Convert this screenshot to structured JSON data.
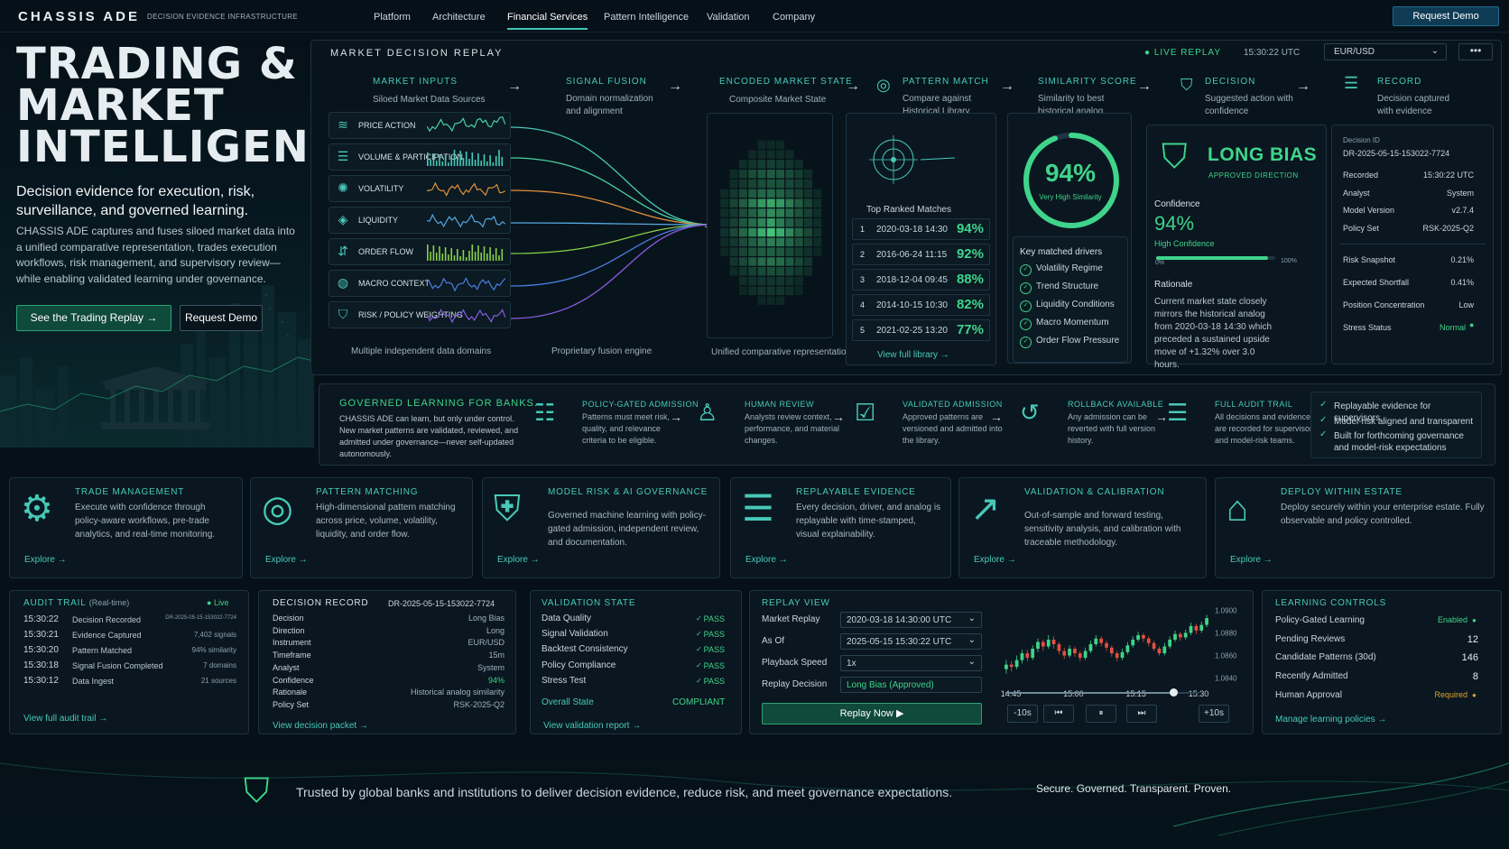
{
  "nav": {
    "logo": "CHASSIS ADE",
    "logo_sub": "DECISION EVIDENCE INFRASTRUCTURE",
    "links": [
      "Platform",
      "Architecture",
      "Financial Services",
      "Pattern Intelligence",
      "Validation",
      "Company"
    ],
    "active": "Financial Services",
    "cta": "Request Demo"
  },
  "hero": {
    "title_lines": [
      "TRADING &",
      "MARKET",
      "INTELLIGENCE"
    ],
    "subtitle": "Decision evidence for execution, risk, surveillance, and governed learning.",
    "body": "CHASSIS ADE captures and fuses siloed market data into a unified comparative representation, trades execution workflows, risk management, and supervisory review—while enabling validated learning under governance.",
    "btn_primary": "See the Trading Replay",
    "btn_secondary": "Request Demo"
  },
  "replay": {
    "title": "MARKET DECISION REPLAY",
    "live": "LIVE REPLAY",
    "time": "15:30:22 UTC",
    "pair": "EUR/USD",
    "more": "•••",
    "stages": [
      {
        "title": "MARKET INPUTS",
        "sub": "Siloed Market Data Sources"
      },
      {
        "title": "SIGNAL FUSION",
        "sub": "Domain normalization and alignment"
      },
      {
        "title": "ENCODED MARKET STATE",
        "sub": "Composite Market State"
      },
      {
        "title": "PATTERN MATCH",
        "sub": "Compare against Historical Library"
      },
      {
        "title": "SIMILARITY SCORE",
        "sub": "Similarity to best historical analog"
      },
      {
        "title": "DECISION",
        "sub": "Suggested action with confidence"
      },
      {
        "title": "RECORD",
        "sub": "Decision captured with evidence"
      }
    ],
    "inputs": [
      {
        "label": "PRICE ACTION",
        "icon": "layers-icon"
      },
      {
        "label": "VOLUME & PARTICIPATION",
        "icon": "database-icon"
      },
      {
        "label": "VOLATILITY",
        "icon": "sun-icon"
      },
      {
        "label": "LIQUIDITY",
        "icon": "drop-icon"
      },
      {
        "label": "ORDER FLOW",
        "icon": "flow-icon"
      },
      {
        "label": "MACRO CONTEXT",
        "icon": "globe-icon"
      },
      {
        "label": "RISK / POLICY WEIGHTING",
        "icon": "shield-gear-icon"
      }
    ],
    "notes": {
      "inputs": "Multiple independent data domains",
      "fusion": "Proprietary fusion engine",
      "state": "Unified comparative representation"
    },
    "matches_title": "Top Ranked Matches",
    "matches": [
      {
        "n": "1",
        "date": "2020-03-18 14:30",
        "pct": "94%"
      },
      {
        "n": "2",
        "date": "2016-06-24 11:15",
        "pct": "92%"
      },
      {
        "n": "3",
        "date": "2018-12-04 09:45",
        "pct": "88%"
      },
      {
        "n": "4",
        "date": "2014-10-15 10:30",
        "pct": "82%"
      },
      {
        "n": "5",
        "date": "2021-02-25 13:20",
        "pct": "77%"
      }
    ],
    "view_library": "View full library",
    "similarity": {
      "value": "94%",
      "label": "Very High Similarity",
      "fraction": 0.94
    },
    "drivers_title": "Key matched drivers",
    "drivers": [
      "Volatility Regime",
      "Trend Structure",
      "Liquidity Conditions",
      "Macro Momentum",
      "Order Flow Pressure"
    ],
    "decision": {
      "bias": "LONG BIAS",
      "approved": "APPROVED DIRECTION",
      "confidence_label": "Confidence",
      "confidence": "94%",
      "confidence_sub": "High Confidence",
      "bar_min": "0%",
      "bar_max": "100%",
      "bar_fraction": 0.94,
      "rationale_label": "Rationale",
      "rationale": "Current market state closely mirrors the historical analog from 2020-03-18 14:30 which preceded a sustained upside move of +1.32% over 3.0 hours."
    },
    "record": {
      "id_label": "Decision ID",
      "id": "DR-2025-05-15-153022-7724",
      "rows": [
        {
          "k": "Recorded",
          "v": "15:30:22 UTC"
        },
        {
          "k": "Analyst",
          "v": "System"
        },
        {
          "k": "Model Version",
          "v": "v2.7.4"
        },
        {
          "k": "Policy Set",
          "v": "RSK-2025-Q2"
        }
      ],
      "risk_rows": [
        {
          "k": "Risk Snapshot",
          "v": "0.21%"
        },
        {
          "k": "Expected Shortfall",
          "v": "0.41%"
        },
        {
          "k": "Position Concentration",
          "v": "Low"
        },
        {
          "k": "Stress Status",
          "v": "Normal"
        }
      ]
    }
  },
  "governed": {
    "title": "GOVERNED LEARNING FOR BANKS.",
    "body": "CHASSIS ADE can learn, but only under control. New market patterns are validated, reviewed, and admitted under governance—never self-updated autonomously.",
    "steps": [
      {
        "title": "POLICY-GATED ADMISSION",
        "text": "Patterns must meet risk, quality, and relevance criteria to be eligible."
      },
      {
        "title": "HUMAN REVIEW",
        "text": "Analysts review context, performance, and material changes."
      },
      {
        "title": "VALIDATED ADMISSION",
        "text": "Approved patterns are versioned and admitted into the library."
      },
      {
        "title": "ROLLBACK AVAILABLE",
        "text": "Any admission can be reverted with full version history."
      },
      {
        "title": "FULL AUDIT TRAIL",
        "text": "All decisions and evidence are recorded for supervisors and model-risk teams."
      }
    ],
    "checks": [
      "Replayable evidence for supervisors",
      "Model-risk aligned and transparent",
      "Built for forthcoming governance and model-risk expectations"
    ]
  },
  "features": [
    {
      "title": "TRADE MANAGEMENT",
      "text": "Execute with confidence through policy-aware workflows, pre-trade analytics, and real-time monitoring.",
      "cta": "Explore",
      "icon": "workflow-icon"
    },
    {
      "title": "PATTERN MATCHING",
      "text": "High-dimensional pattern matching across price, volume, volatility, liquidity, and order flow.",
      "cta": "Explore",
      "icon": "target-icon"
    },
    {
      "title": "MODEL RISK & AI GOVERNANCE",
      "text": "Governed machine learning with policy-gated admission, independent review, and documentation.",
      "cta": "Explore",
      "icon": "shield-icon"
    },
    {
      "title": "REPLAYABLE EVIDENCE",
      "text": "Every decision, driver, and analog is replayable with time-stamped, visual explainability.",
      "cta": "Explore",
      "icon": "database-lock-icon"
    },
    {
      "title": "VALIDATION & CALIBRATION",
      "text": "Out-of-sample and forward testing, sensitivity analysis, and calibration with traceable methodology.",
      "cta": "Explore",
      "icon": "chart-up-icon"
    },
    {
      "title": "DEPLOY WITHIN ESTATE",
      "text": "Deploy securely within your enterprise estate. Fully observable and policy controlled.",
      "cta": "Explore",
      "icon": "building-lock-icon"
    }
  ],
  "audit": {
    "title": "AUDIT TRAIL",
    "sub": "(Real-time)",
    "live": "Live",
    "rows": [
      {
        "t": "15:30:22",
        "e": "Decision Recorded",
        "v": "DR-2025-05-15-153022-7724"
      },
      {
        "t": "15:30:21",
        "e": "Evidence Captured",
        "v": "7,402 signals"
      },
      {
        "t": "15:30:20",
        "e": "Pattern Matched",
        "v": "94% similarity"
      },
      {
        "t": "15:30:18",
        "e": "Signal Fusion Completed",
        "v": "7 domains"
      },
      {
        "t": "15:30:12",
        "e": "Data Ingest",
        "v": "21 sources"
      }
    ],
    "link": "View full audit trail"
  },
  "decision_record": {
    "title": "DECISION RECORD",
    "id": "DR-2025-05-15-153022-7724",
    "rows": [
      {
        "k": "Decision",
        "v": "Long Bias"
      },
      {
        "k": "Direction",
        "v": "Long"
      },
      {
        "k": "Instrument",
        "v": "EUR/USD"
      },
      {
        "k": "Timeframe",
        "v": "15m"
      },
      {
        "k": "Analyst",
        "v": "System"
      },
      {
        "k": "Confidence",
        "v": "94%"
      },
      {
        "k": "Rationale",
        "v": "Historical analog similarity"
      },
      {
        "k": "Policy Set",
        "v": "RSK-2025-Q2"
      }
    ],
    "link": "View decision packet"
  },
  "validation": {
    "title": "VALIDATION STATE",
    "rows": [
      {
        "k": "Data Quality",
        "v": "PASS"
      },
      {
        "k": "Signal Validation",
        "v": "PASS"
      },
      {
        "k": "Backtest Consistency",
        "v": "PASS"
      },
      {
        "k": "Policy Compliance",
        "v": "PASS"
      },
      {
        "k": "Stress Test",
        "v": "PASS"
      }
    ],
    "overall_label": "Overall State",
    "overall": "COMPLIANT",
    "link": "View validation report"
  },
  "replay_view": {
    "title": "REPLAY VIEW",
    "fields": [
      {
        "k": "Market Replay",
        "v": "2020-03-18 14:30:00 UTC",
        "select": true
      },
      {
        "k": "As Of",
        "v": "2025-05-15 15:30:22 UTC",
        "select": true
      },
      {
        "k": "Playback Speed",
        "v": "1x",
        "select": true
      },
      {
        "k": "Replay Decision",
        "v": "Long Bias (Approved)",
        "select": false
      }
    ],
    "button": "Replay Now",
    "controls": [
      "-10s",
      "⏮",
      "⏸",
      "⏭",
      "+10s"
    ],
    "progress": 0.87
  },
  "chart_data": {
    "type": "candlestick",
    "x_ticks": [
      "14:45",
      "15:00",
      "15:15",
      "15:30"
    ],
    "y_ticks": [
      "1.0900",
      "1.0880",
      "1.0860",
      "1.0840"
    ],
    "ylim": [
      1.0835,
      1.0905
    ],
    "candles": [
      [
        1.0848,
        1.0852,
        1.0844,
        1.0856
      ],
      [
        1.0852,
        1.085,
        1.0846,
        1.0855
      ],
      [
        1.085,
        1.0856,
        1.0848,
        1.086
      ],
      [
        1.0856,
        1.0862,
        1.0853,
        1.0865
      ],
      [
        1.0862,
        1.0858,
        1.0855,
        1.0865
      ],
      [
        1.0858,
        1.0866,
        1.0856,
        1.0869
      ],
      [
        1.0866,
        1.0872,
        1.0863,
        1.0875
      ],
      [
        1.0872,
        1.0868,
        1.0864,
        1.0874
      ],
      [
        1.0868,
        1.0874,
        1.0866,
        1.0878
      ],
      [
        1.0874,
        1.087,
        1.0866,
        1.0877
      ],
      [
        1.087,
        1.0864,
        1.0861,
        1.0872
      ],
      [
        1.0864,
        1.086,
        1.0857,
        1.0867
      ],
      [
        1.086,
        1.0866,
        1.0858,
        1.0869
      ],
      [
        1.0866,
        1.0862,
        1.0859,
        1.0868
      ],
      [
        1.0862,
        1.0858,
        1.0855,
        1.0864
      ],
      [
        1.0858,
        1.0864,
        1.0856,
        1.0867
      ],
      [
        1.0864,
        1.087,
        1.0862,
        1.0873
      ],
      [
        1.087,
        1.0875,
        1.0868,
        1.0878
      ],
      [
        1.0875,
        1.0871,
        1.0868,
        1.0877
      ],
      [
        1.0871,
        1.0867,
        1.0864,
        1.0873
      ],
      [
        1.0867,
        1.0862,
        1.0859,
        1.0869
      ],
      [
        1.0862,
        1.0858,
        1.0855,
        1.0864
      ],
      [
        1.0858,
        1.0863,
        1.0856,
        1.0866
      ],
      [
        1.0863,
        1.0869,
        1.0861,
        1.0872
      ],
      [
        1.0869,
        1.0874,
        1.0867,
        1.0877
      ],
      [
        1.0874,
        1.0878,
        1.0872,
        1.0881
      ],
      [
        1.0878,
        1.0875,
        1.0872,
        1.088
      ],
      [
        1.0875,
        1.0871,
        1.0868,
        1.0877
      ],
      [
        1.0871,
        1.0866,
        1.0864,
        1.0873
      ],
      [
        1.0866,
        1.0862,
        1.086,
        1.0868
      ],
      [
        1.0862,
        1.0868,
        1.086,
        1.0871
      ],
      [
        1.0868,
        1.0874,
        1.0866,
        1.0877
      ],
      [
        1.0874,
        1.0879,
        1.0872,
        1.0882
      ],
      [
        1.0879,
        1.0876,
        1.0873,
        1.0881
      ],
      [
        1.0876,
        1.088,
        1.0874,
        1.0883
      ],
      [
        1.088,
        1.0886,
        1.0878,
        1.0889
      ],
      [
        1.0886,
        1.0882,
        1.0879,
        1.0888
      ],
      [
        1.0882,
        1.0887,
        1.088,
        1.089
      ],
      [
        1.0887,
        1.0893,
        1.0885,
        1.0896
      ]
    ]
  },
  "learning": {
    "title": "LEARNING CONTROLS",
    "rows": [
      {
        "k": "Policy-Gated Learning",
        "v": "Enabled",
        "status": "green"
      },
      {
        "k": "Pending Reviews",
        "v": "12",
        "status": ""
      },
      {
        "k": "Candidate Patterns (30d)",
        "v": "146",
        "status": ""
      },
      {
        "k": "Recently Admitted",
        "v": "8",
        "status": ""
      },
      {
        "k": "Human Approval",
        "v": "Required",
        "status": "orange"
      }
    ],
    "link": "Manage learning policies"
  },
  "footer": {
    "text": "Trusted by global banks and institutions to deliver decision evidence, reduce risk, and meet governance expectations.",
    "tagline": "Secure. Governed. Transparent. Proven."
  },
  "colors": {
    "accent": "#48c9b8",
    "positive": "#3fd48a",
    "negative": "#e0503f",
    "warning": "#e0a030",
    "background": "#061018"
  }
}
